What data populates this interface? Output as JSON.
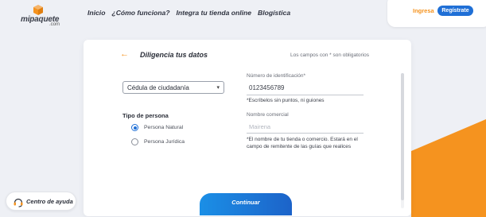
{
  "colors": {
    "accent": "#f5931f",
    "primary": "#1f6fd6",
    "background": "#eef0f5"
  },
  "logo": {
    "text": "mipaquete",
    "domain": ".com"
  },
  "nav": [
    "Inicio",
    "¿Cómo funciona?",
    "Integra tu tienda online",
    "Blogística"
  ],
  "auth": {
    "login": "Ingresa",
    "register": "Regístrate"
  },
  "form": {
    "title": "Diligencia tus datos",
    "required_note": "Los campos con * son obligatorios",
    "document_type": "Cédula de ciudadanía",
    "id_label": "Número de identificación*",
    "id_value": "0123456789",
    "id_hint": "*Escríbelos sin puntos, ni guiones",
    "person_type_label": "Tipo de persona",
    "person_types": [
      "Persona Natural",
      "Persona Jurídica"
    ],
    "selected_person_type": "Persona Natural",
    "trade_name_label": "Nombre comercial",
    "trade_name_placeholder": "Mairena",
    "trade_name_hint_1": "*El nombre de tu tienda o comercio. Estará en el",
    "trade_name_hint_2": "campo de remitente de las guías que realices",
    "continue": "Continuar"
  },
  "help": {
    "label": "Centro de ayuda",
    "icon": "headset-icon"
  }
}
